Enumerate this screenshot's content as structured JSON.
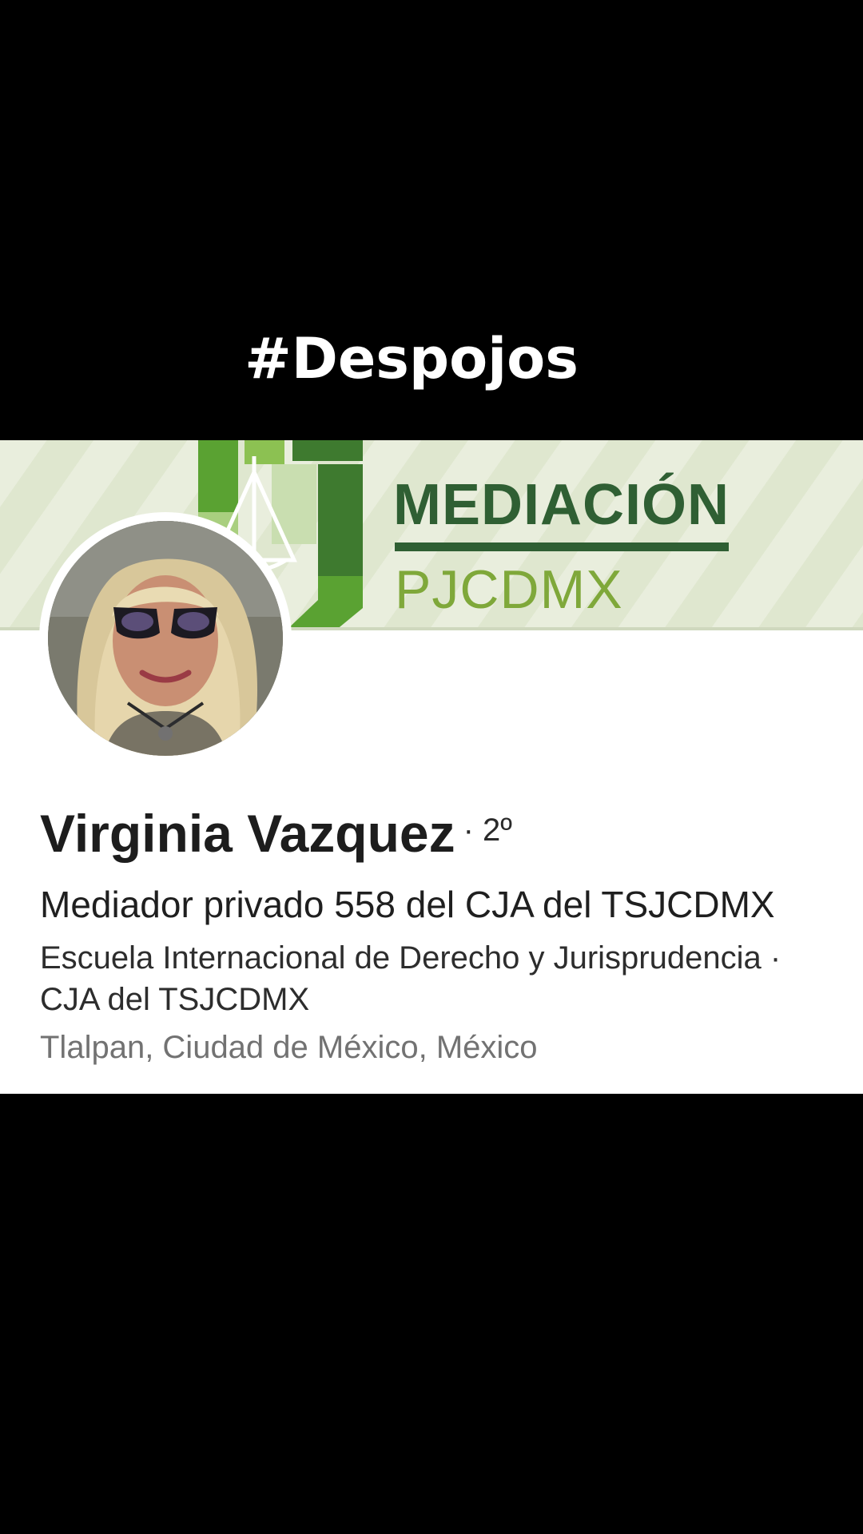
{
  "overlay": {
    "hashtag": "#Despojos"
  },
  "profile": {
    "banner": {
      "title": "MEDIACIÓN",
      "subtitle": "PJCDMX",
      "colors": {
        "dark_green": "#2f5f33",
        "light_green": "#7fa83a",
        "mid_green": "#4f9a2f"
      }
    },
    "avatar_icon": "profile-photo",
    "name": "Virginia Vazquez",
    "connection_degree": "· 2º",
    "headline": "Mediador privado 558 del CJA del TSJCDMX",
    "education_line1": "Escuela Internacional de Derecho y Jurisprudencia ·",
    "education_line2": "CJA del TSJCDMX",
    "location": "Tlalpan, Ciudad de México, México"
  }
}
